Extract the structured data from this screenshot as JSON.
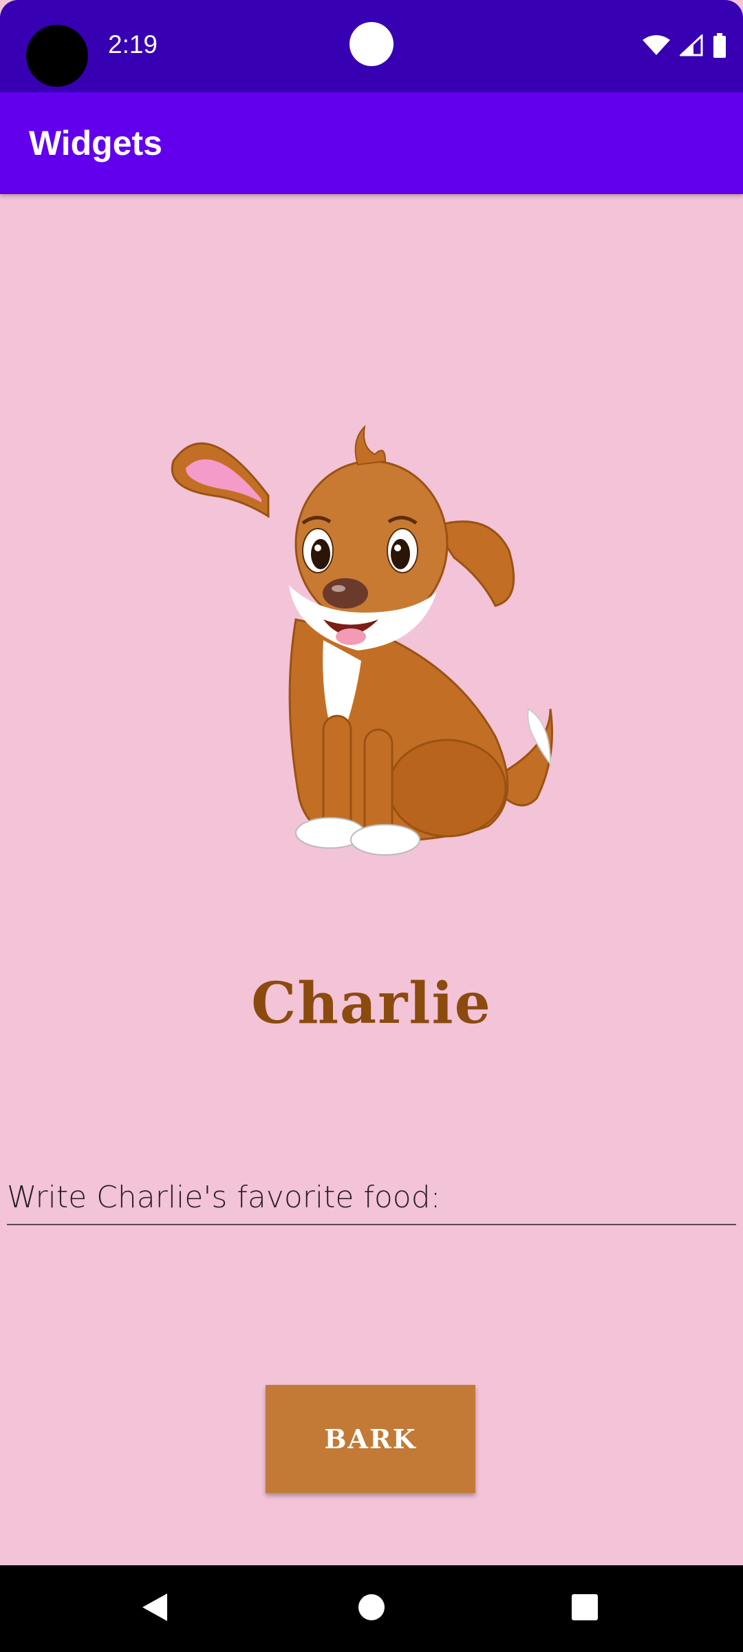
{
  "status_bar": {
    "time": "2:19",
    "icons": [
      "wifi-icon",
      "signal-icon",
      "battery-icon"
    ]
  },
  "app_bar": {
    "title": "Widgets",
    "color": "#6200EE"
  },
  "main": {
    "background_color": "#F3C3D8",
    "dog_name": "Charlie",
    "food_input": {
      "placeholder": "Write Charlie's favorite food:",
      "value": ""
    },
    "bark_button": {
      "label": "BARK",
      "color": "#C27A36"
    }
  },
  "nav_bar": {
    "buttons": [
      "back-icon",
      "home-icon",
      "recents-icon"
    ]
  }
}
